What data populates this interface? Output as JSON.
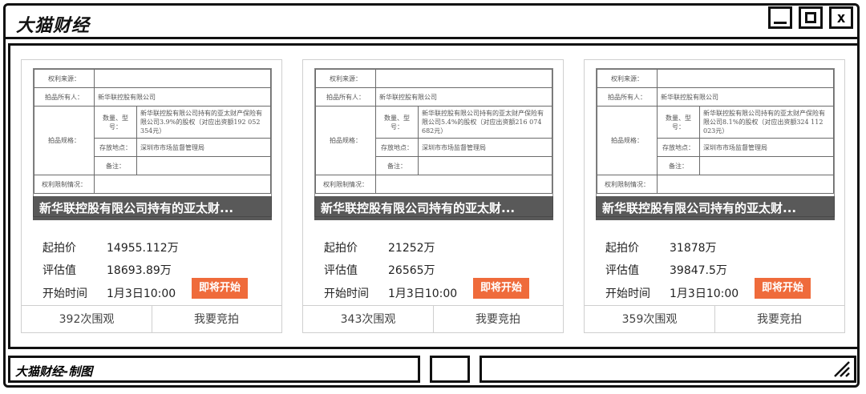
{
  "app": {
    "title": "大猫财经"
  },
  "window_controls": {
    "minimize": "minimize-icon",
    "maximize": "maximize-icon",
    "close": "x"
  },
  "doc_table": {
    "rights_source": "权利来源：",
    "owner_label": "拍品所有人：",
    "owner_value": "新华联控股有限公司",
    "spec_label": "拍品规格：",
    "qty_label": "数量、型号：",
    "location_label": "存放地点：",
    "location_value": "深圳市市场监督管理局",
    "note_label": "备注：",
    "restriction_label": "权利限制情况："
  },
  "cards": [
    {
      "qty_value": "新华联控股有限公司持有的亚太财产保险有限公司3.9%的股权（对应出资额192 052 354元）",
      "title": "新华联控股有限公司持有的亚太财...",
      "start_price_label": "起拍价",
      "start_price": "14955.112万",
      "appraisal_label": "评估值",
      "appraisal": "18693.89万",
      "start_time_label": "开始时间",
      "start_time": "1月3日10:00",
      "status": "即将开始",
      "views": "392次围观",
      "bid": "我要竞拍"
    },
    {
      "qty_value": "新华联控股有限公司持有的亚太财产保险有限公司5.4%的股权（对应出资额216 074 682元）",
      "title": "新华联控股有限公司持有的亚太财...",
      "start_price_label": "起拍价",
      "start_price": "21252万",
      "appraisal_label": "评估值",
      "appraisal": "26565万",
      "start_time_label": "开始时间",
      "start_time": "1月3日10:00",
      "status": "即将开始",
      "views": "343次围观",
      "bid": "我要竞拍"
    },
    {
      "qty_value": "新华联控股有限公司持有的亚太财产保险有限公司8.1%的股权（对应出资额324 112 023元）",
      "title": "新华联控股有限公司持有的亚太财...",
      "start_price_label": "起拍价",
      "start_price": "31878万",
      "appraisal_label": "评估值",
      "appraisal": "39847.5万",
      "start_time_label": "开始时间",
      "start_time": "1月3日10:00",
      "status": "即将开始",
      "views": "359次围观",
      "bid": "我要竞拍"
    }
  ],
  "footer": {
    "credit": "大猫财经-制图"
  },
  "colors": {
    "accent": "#ef6b3b",
    "caption_bg": "#3c3c3c",
    "border": "#111111"
  }
}
